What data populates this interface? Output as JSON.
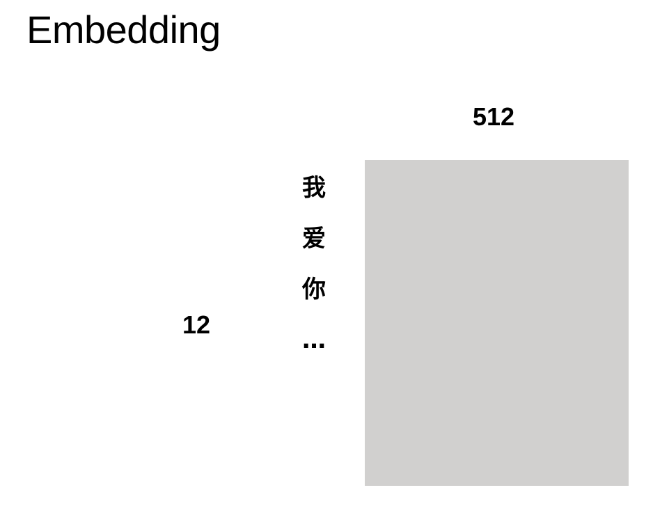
{
  "title": "Embedding",
  "matrix": {
    "width_label": "512",
    "height_label": "12",
    "fill_color": "#d1d0cf"
  },
  "tokens": [
    "我",
    "爱",
    "你",
    "…"
  ]
}
